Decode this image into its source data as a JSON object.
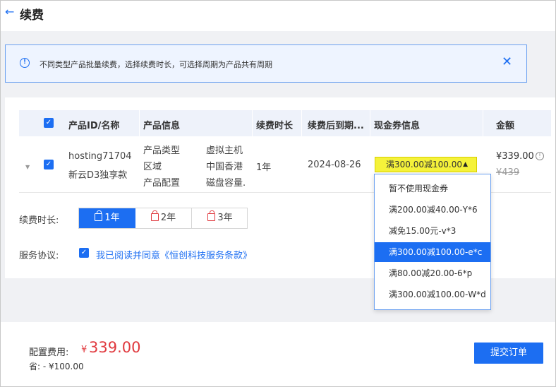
{
  "header": {
    "title": "续费"
  },
  "notice": {
    "text": "不同类型产品批量续费，选择续费时长，可选择周期为产品共有周期"
  },
  "table": {
    "columns": [
      "产品ID/名称",
      "产品信息",
      "续费时长",
      "续费后到期...",
      "现金券信息",
      "金额"
    ],
    "row": {
      "product_id": "hosting71704",
      "product_name": "新云D3独享款",
      "info": [
        {
          "key": "产品类型",
          "value": "虚拟主机"
        },
        {
          "key": "区域",
          "value": "中国香港"
        },
        {
          "key": "产品配置",
          "value": "磁盘容量."
        }
      ],
      "duration": "1年",
      "expiry": "2024-08-26",
      "coupon_selected": "满300.00减100.00",
      "price": "¥339.00",
      "original_price": "¥439"
    }
  },
  "coupon_options": [
    "暂不使用现金券",
    "满200.00减40.00-Y*6",
    "减免15.00元-v*3",
    "满300.00减100.00-e*c",
    "满80.00减20.00-6*p",
    "满300.00减100.00-W*d"
  ],
  "renew": {
    "label": "续费时长:",
    "options": [
      "1年",
      "2年",
      "3年"
    ],
    "selected": "1年"
  },
  "agreement": {
    "label": "服务协议:",
    "text": "我已阅读并同意《恒创科技服务条款》"
  },
  "footer": {
    "fee_label": "配置费用:",
    "currency": "¥",
    "fee_value": "339.00",
    "save_text": "省: - ¥100.00",
    "submit_label": "提交订单"
  },
  "colors": {
    "primary": "#1c6ef2",
    "price_red": "#e0393e",
    "coupon_highlight": "#f5f23a"
  }
}
